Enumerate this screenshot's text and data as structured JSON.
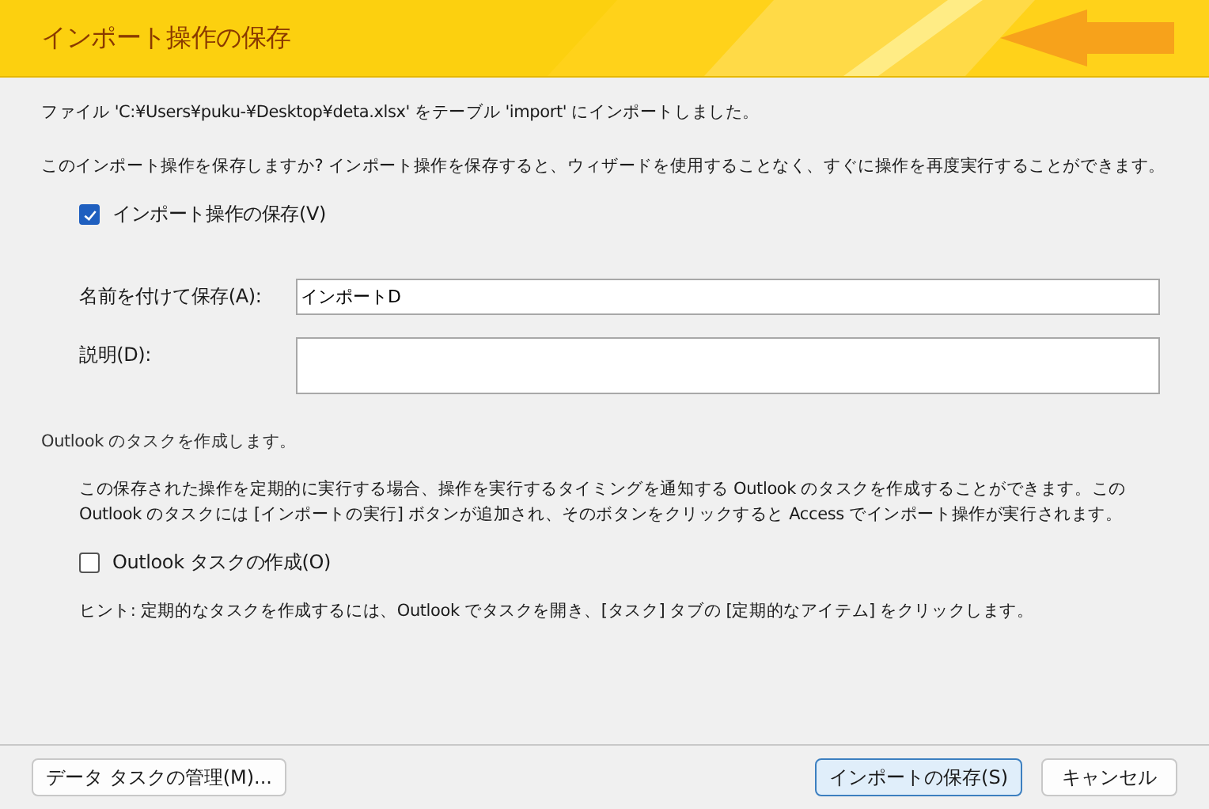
{
  "window": {
    "title": "インポート操作の保存"
  },
  "message": "ファイル 'C:¥Users¥puku-¥Desktop¥deta.xlsx' をテーブル 'import' にインポートしました。",
  "question": "このインポート操作を保存しますか? インポート操作を保存すると、ウィザードを使用することなく、すぐに操作を再度実行することができます。",
  "save_checkbox": {
    "label": "インポート操作の保存(V)",
    "checked": true
  },
  "fields": [
    {
      "label": "名前を付けて保存(A):",
      "value": "インポートD",
      "kind": "single"
    },
    {
      "label": "説明(D):",
      "kind": "multi"
    }
  ],
  "outlook_section": {
    "heading": "Outlook のタスクを作成します。",
    "description": "この保存された操作を定期的に実行する場合、操作を実行するタイミングを通知する Outlook のタスクを作成することができます。この Outlook のタスクには [インポートの実行] ボタンが追加され、そのボタンをクリックすると Access でインポート操作が実行されます。",
    "checkbox": {
      "label": "Outlook タスクの作成(O)",
      "checked": false
    },
    "hint": "ヒント: 定期的なタスクを作成するには、Outlook でタスクを開き、[タスク] タブの [定期的なアイテム] をクリックします。"
  },
  "buttons": [
    {
      "label": "データ タスクの管理(M)...",
      "kind": "left"
    },
    {
      "label": "インポートの保存(S)",
      "kind": "default"
    },
    {
      "label": "キャンセル",
      "kind": "normal"
    }
  ]
}
